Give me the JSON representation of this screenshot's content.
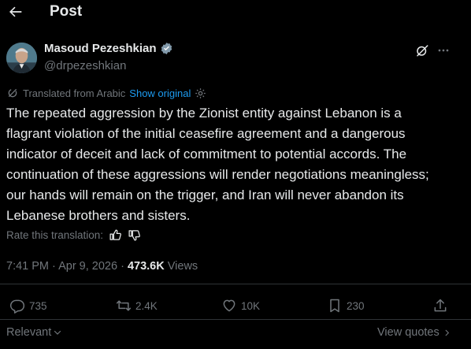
{
  "header": {
    "title": "Post"
  },
  "author": {
    "name": "Masoud Pezeshkian",
    "handle": "@drpezeshkian"
  },
  "translation": {
    "label": "Translated from Arabic",
    "show_original": "Show original",
    "rate_label": "Rate this translation:"
  },
  "post": {
    "text": "The repeated aggression by the Zionist entity against Lebanon is a flagrant violation of the initial ceasefire agreement and a dangerous indicator of deceit and lack of commitment to potential accords. The continuation of these aggressions will render negotiations meaningless; our hands will remain on the trigger, and Iran will never abandon its Lebanese brothers and sisters.",
    "timestamp": "7:41 PM · Apr 9, 2026 · ",
    "views_count": "473.6K",
    "views_label": " Views"
  },
  "stats": {
    "replies": "735",
    "reposts": "2.4K",
    "likes": "10K",
    "bookmarks": "230"
  },
  "footer": {
    "sort_label": "Relevant",
    "view_quotes": "View quotes"
  },
  "icons": {
    "back": "arrow-left-icon",
    "verified": "verified-badge-icon",
    "grok": "grok-icon",
    "more": "more-icon",
    "translate": "translate-icon",
    "settings": "gear-icon",
    "thumbs_up": "thumbs-up-icon",
    "thumbs_down": "thumbs-down-icon",
    "reply": "reply-icon",
    "repost": "repost-icon",
    "like": "heart-icon",
    "bookmark": "bookmark-icon",
    "share": "share-icon"
  },
  "colors": {
    "background": "#000000",
    "text": "#e7e9ea",
    "muted": "#71767b",
    "accent": "#1d9bf0"
  }
}
